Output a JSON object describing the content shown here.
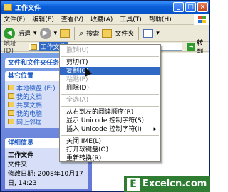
{
  "window": {
    "title": "工作文件"
  },
  "menubar": {
    "items": [
      "文件(F)",
      "编辑(E)",
      "查看(V)",
      "收藏(A)",
      "工具(T)",
      "帮助(H)"
    ]
  },
  "toolbar": {
    "back_label": "后退",
    "search_label": "搜索",
    "folders_label": "文件夹"
  },
  "address": {
    "label": "地址(D)",
    "value": "工作文件",
    "go_label": "转到"
  },
  "leftpane": {
    "tasks_title": "文件和文件夹任务",
    "places_title": "其它位置",
    "places": [
      "本地磁盘 (E:)",
      "我的文档",
      "共享文档",
      "我的电脑",
      "网上邻居"
    ],
    "details_title": "详细信息",
    "details_name": "工作文件",
    "details_type": "文件夹",
    "details_modified_label": "修改日期: 2008年10月17日, 14:23"
  },
  "context_menu": {
    "items": [
      {
        "label": "撤销(U)",
        "state": "disabled"
      },
      {
        "sep": true
      },
      {
        "label": "剪切(T)",
        "state": "normal"
      },
      {
        "label": "复制(C)",
        "state": "highlighted"
      },
      {
        "label": "粘贴(P)",
        "state": "disabled"
      },
      {
        "label": "删除(D)",
        "state": "normal"
      },
      {
        "sep": true
      },
      {
        "label": "全选(A)",
        "state": "disabled"
      },
      {
        "sep": true
      },
      {
        "label": "从右到左的阅读顺序(R)",
        "state": "normal"
      },
      {
        "label": "显示 Unicode 控制字符(S)",
        "state": "normal"
      },
      {
        "label": "插入 Unicode 控制字符(I)",
        "state": "normal",
        "submenu": true
      },
      {
        "sep": true
      },
      {
        "label": "关闭 IME(L)",
        "state": "normal"
      },
      {
        "label": "打开软键盘(O)",
        "state": "normal"
      },
      {
        "label": "重新转换(R)",
        "state": "normal"
      }
    ]
  },
  "watermark": {
    "logo": "E",
    "text": "Excelcn.com"
  }
}
